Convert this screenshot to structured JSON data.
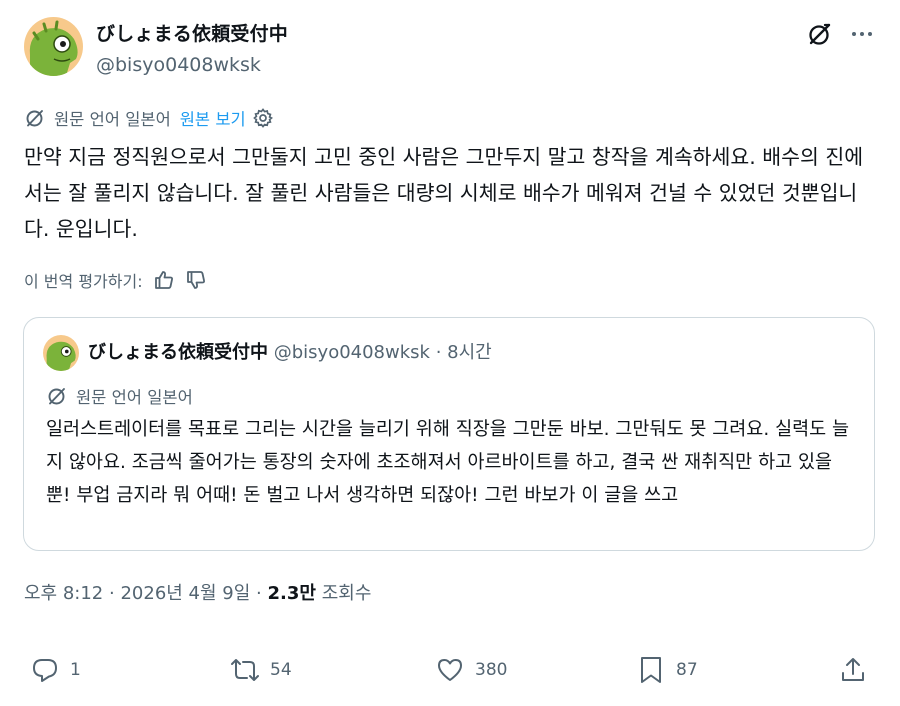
{
  "author": {
    "display_name": "びしょまる依頼受付中",
    "handle": "@bisyo0408wksk"
  },
  "translation": {
    "source_label": "원문 언어 일본어",
    "show_original": "원본 보기"
  },
  "tweet_text": "만약 지금 정직원으로서 그만둘지 고민 중인 사람은 그만두지 말고 창작을 계속하세요. 배수의 진에서는 잘 풀리지 않습니다. 잘 풀린 사람들은 대량의 시체로 배수가 메워져 건널 수 있었던 것뿐입니다. 운입니다.",
  "rate_translation": "이 번역 평가하기:",
  "quote": {
    "display_name": "びしょまる依頼受付中",
    "handle": "@bisyo0408wksk",
    "separator": "·",
    "time": "8시간",
    "source_label": "원문 언어 일본어",
    "text": "일러스트레이터를 목표로 그리는 시간을 늘리기 위해 직장을 그만둔 바보. 그만둬도 못 그려요. 실력도 늘지 않아요. 조금씩 줄어가는 통장의 숫자에 초조해져서 아르바이트를 하고, 결국 싼 재취직만 하고 있을 뿐! 부업 금지라 뭐 어때! 돈 벌고 나서 생각하면 되잖아! 그런 바보가 이 글을 쓰고"
  },
  "meta": {
    "time": "오후 8:12",
    "separator": "·",
    "date": "2026년 4월 9일",
    "views_count": "2.3만",
    "views_label": "조회수"
  },
  "actions": {
    "replies": "1",
    "reposts": "54",
    "likes": "380",
    "bookmarks": "87"
  },
  "colors": {
    "text_primary": "#0f1419",
    "text_secondary": "#536471",
    "link": "#1d9bf0",
    "border": "#cfd9de",
    "avatar_bg": "#f7c98b",
    "avatar_character": "#7bb33a"
  },
  "icons": [
    "grok-icon",
    "more-icon",
    "translate-icon",
    "gear-icon",
    "thumb-up-icon",
    "thumb-down-icon",
    "reply-icon",
    "repost-icon",
    "like-icon",
    "bookmark-icon",
    "share-icon"
  ]
}
